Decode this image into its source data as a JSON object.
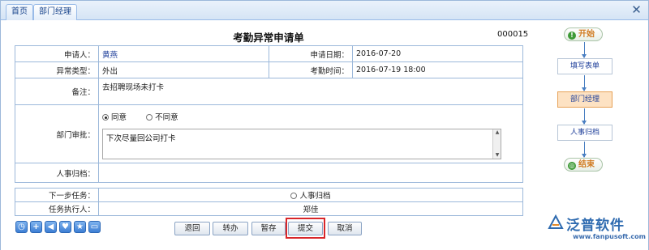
{
  "tabs": [
    {
      "label": "首页"
    },
    {
      "label": "部门经理"
    }
  ],
  "form": {
    "title": "考勤异常申请单",
    "number": "000015",
    "rows": {
      "applicant_label": "申请人：",
      "applicant_value": "黄燕",
      "apply_date_label": "申请日期：",
      "apply_date_value": "2016-07-20",
      "type_label": "异常类型：",
      "type_value": "外出",
      "attendance_time_label": "考勤时间：",
      "attendance_time_value": "2016-07-19 18:00",
      "remark_label": "备注：",
      "remark_value": "去招聘现场未打卡",
      "dept_approval_label": "部门审批：",
      "agree_label": "同意",
      "disagree_label": "不同意",
      "approval_comment": "下次尽量回公司打卡",
      "hr_archive_label": "人事归档："
    },
    "next": {
      "next_task_label": "下一步任务：",
      "next_task_value": "人事归档",
      "executor_label": "任务执行人：",
      "executor_value": "郑佳"
    }
  },
  "buttons": {
    "back": "退回",
    "transfer": "转办",
    "save_draft": "暂存",
    "submit": "提交",
    "cancel": "取消"
  },
  "toolbar_icons": [
    "clock-icon",
    "add-icon",
    "speaker-icon",
    "heart-icon",
    "star-icon",
    "print-icon"
  ],
  "flow": {
    "start": "开始",
    "step1": "填写表单",
    "step2": "部门经理",
    "step3": "人事归档",
    "end": "结束"
  },
  "brand": {
    "name": "泛普软件",
    "url": "www.fanpusoft.com",
    "color": "#2f6bb0"
  }
}
